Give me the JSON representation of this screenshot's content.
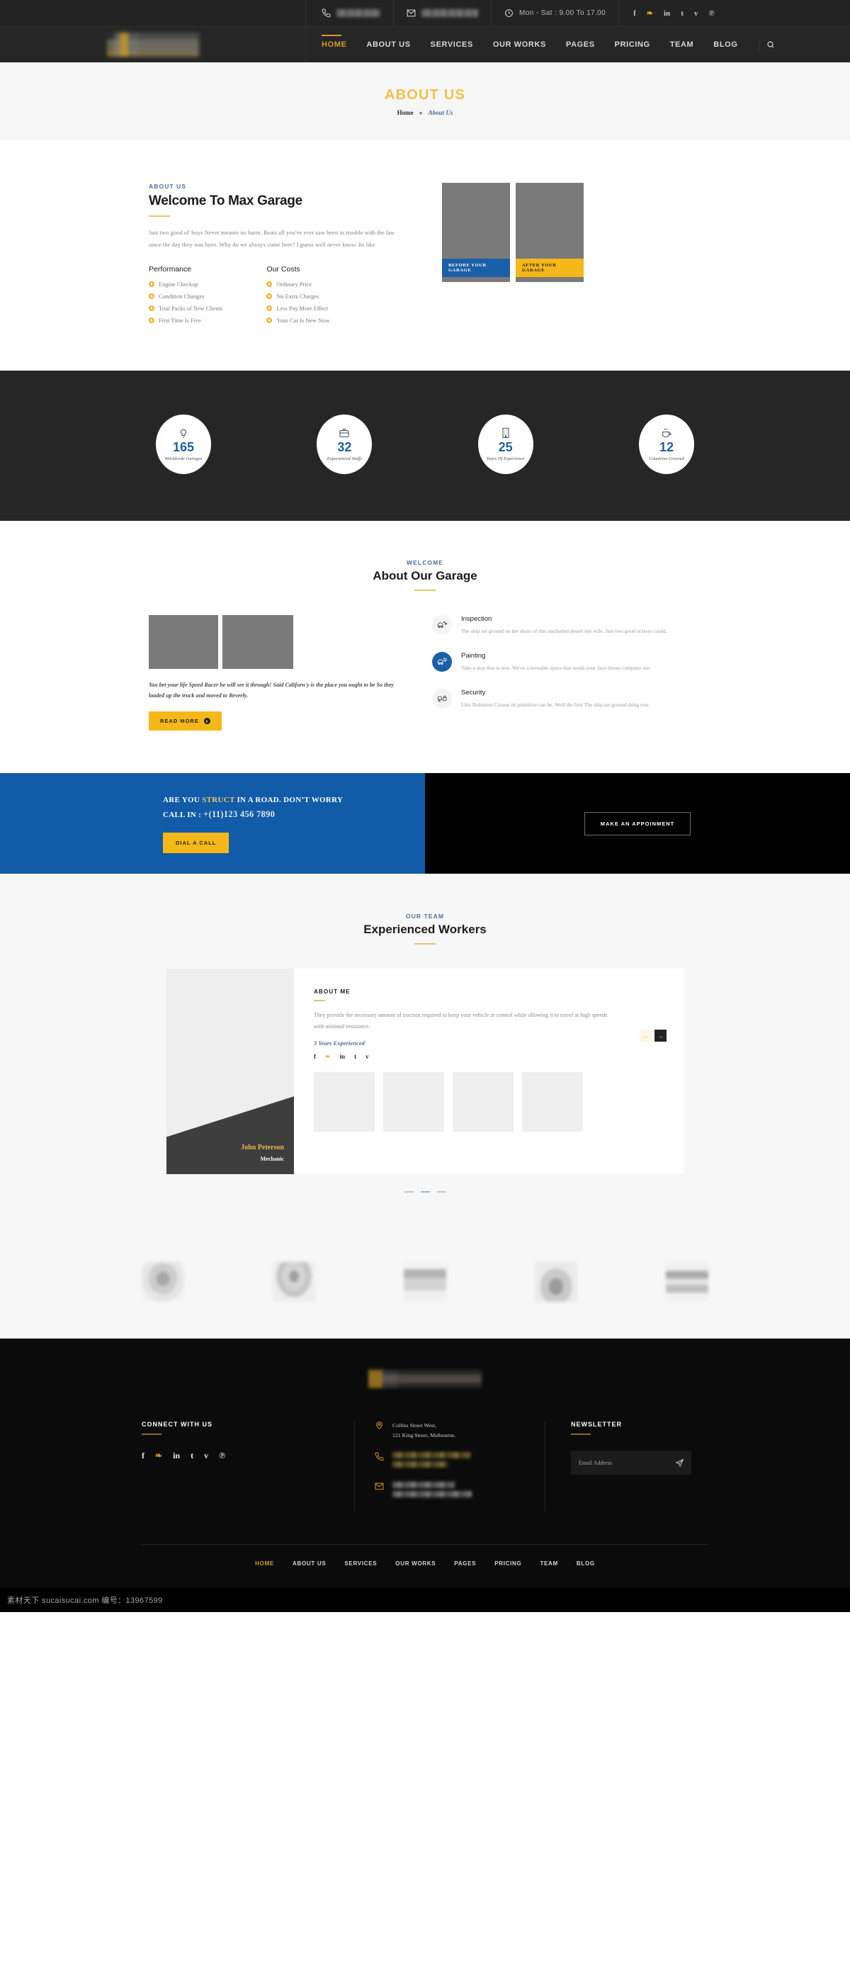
{
  "topbar": {
    "phone_masked": "",
    "email_masked": "",
    "hours": "Mon - Sat : 9.00 To 17.00",
    "socials": [
      "f",
      "❧",
      "in",
      "t",
      "v",
      "℗"
    ]
  },
  "nav": {
    "items": [
      {
        "label": "HOME",
        "active": true
      },
      {
        "label": "ABOUT US",
        "active": false
      },
      {
        "label": "SERVICES",
        "active": false
      },
      {
        "label": "OUR WORKS",
        "active": false
      },
      {
        "label": "PAGES",
        "active": false
      },
      {
        "label": "PRICING",
        "active": false
      },
      {
        "label": "TEAM",
        "active": false
      },
      {
        "label": "BLOG",
        "active": false
      }
    ],
    "search_icon": "search-icon"
  },
  "page_title": {
    "title": "ABOUT US",
    "breadcrumb_home": "Home",
    "breadcrumb_sep": "»",
    "breadcrumb_current": "About Us"
  },
  "about": {
    "eyebrow": "ABOUT US",
    "heading": "Welcome To Max Garage",
    "paragraph": "Just two good ol' boys Never meanin no harm. Beats all you've ever saw been in trouble with the law since the day they was born. Why do we always come here? I guess well never know. Its like",
    "col1_title": "Performance",
    "col1_items": [
      "Engine Checkup",
      "Condition Changes",
      "Trial Packs of New Clients",
      "First Time Is Free"
    ],
    "col2_title": "Our Costs",
    "col2_items": [
      "Ordinary Price",
      "No Extra Charges",
      "Less Pay More Effect",
      "Your Car Is New Now"
    ],
    "before_tag": "BEFORE YOUR GARAGE",
    "after_tag": "AFTER YOUR GARAGE",
    "before_color": "#1a5fa8",
    "after_color": "#f5b81a"
  },
  "counters": [
    {
      "icon": "lightbulb-icon",
      "value": "165",
      "label": "Worldwide Garages"
    },
    {
      "icon": "briefcase-icon",
      "value": "32",
      "label": "Experienced Staffs"
    },
    {
      "icon": "building-icon",
      "value": "25",
      "label": "Years Of Experience"
    },
    {
      "icon": "coffee-cup-icon",
      "value": "12",
      "label": "Countries Covered"
    }
  ],
  "garage": {
    "eyebrow": "WELCOME",
    "heading": "About Our Garage",
    "quote": "You bet your life Speed Racer he will see it through! Said Californ'y is the place you ought to be So they loaded up the truck and moved to Beverly.",
    "read_more": "READ MORE",
    "services": [
      {
        "icon": "car-wrench-icon",
        "title": "Inspection",
        "text": "The ship set ground on the shore of this uncharted desert isle wife. Just two good ol boys could.",
        "active": false
      },
      {
        "icon": "car-paint-icon",
        "title": "Painting",
        "text": "Take a step that is new. We've a loveable space that needs your face threes company too.",
        "active": true
      },
      {
        "icon": "car-lock-icon",
        "title": "Security",
        "text": "Like Robinson Crusoe its primitive can be. Well the first The ship set ground thing you.",
        "active": false
      }
    ]
  },
  "cta": {
    "line1_a": "ARE YOU ",
    "line1_hl": "STRUCT",
    "line1_b": " IN A ROAD. DON’T WORRY",
    "line2_label": "CALL IN : ",
    "phone": "+(11)123 456 7890",
    "dial_button": "DIAL A CALL",
    "appointment_button": "MAKE AN APPOINMENT",
    "blue": "#115ba8"
  },
  "team": {
    "eyebrow": "OUR TEAM",
    "heading": "Experienced Workers",
    "member_name": "John Peterson",
    "member_role": "Mechanic",
    "about_label": "ABOUT ME",
    "about_text": "They provide the necessary amount of traction required to keep your vehicle in control while allowing it to travel at high speeds with minimal resistance.",
    "experience": "5 Years Experienced",
    "socials": [
      "f",
      "❧",
      "in",
      "t",
      "v"
    ],
    "prev_icon": "arrow-left-icon",
    "next_icon": "arrow-right-icon",
    "thumb_count": 4,
    "dots": 3,
    "active_dot": 1
  },
  "clients": {
    "count": 5
  },
  "footer": {
    "connect_title": "CONNECT WITH US",
    "socials": [
      "f",
      "❧",
      "in",
      "t",
      "v",
      "℗"
    ],
    "address_line1": "Collins Street West,",
    "address_line2": "121 King Street, Melbourne.",
    "phone_masked": "",
    "email_masked": "",
    "newsletter_title": "NEWSLETTER",
    "newsletter_placeholder": "Email Address",
    "newsletter_value": "",
    "send_icon": "send-icon",
    "nav": [
      "HOME",
      "ABOUT US",
      "SERVICES",
      "OUR WORKS",
      "PAGES",
      "PRICING",
      "TEAM",
      "BLOG"
    ]
  },
  "watermark": "素材天下 sucaisucai.com  编号：13967599"
}
